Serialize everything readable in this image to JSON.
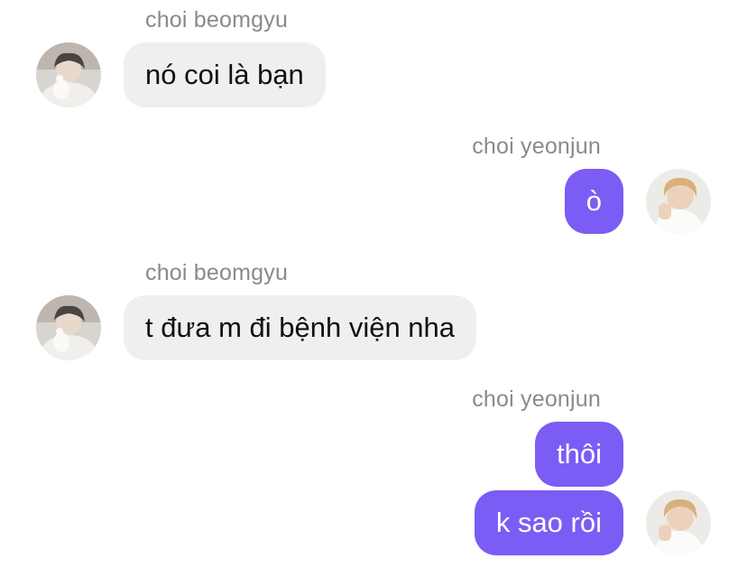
{
  "messages": [
    {
      "sender": "choi beomgyu",
      "text": "nó coi là bạn"
    },
    {
      "sender": "choi yeonjun",
      "text": "ò"
    },
    {
      "sender": "choi beomgyu",
      "text": "t đưa m đi bệnh viện nha"
    },
    {
      "sender": "choi yeonjun",
      "text": "thôi"
    },
    {
      "text": "k sao rồi"
    }
  ],
  "colors": {
    "incoming_bubble": "#efefef",
    "outgoing_bubble": "#7b5cf5",
    "sender_name": "#8a8a8e"
  }
}
